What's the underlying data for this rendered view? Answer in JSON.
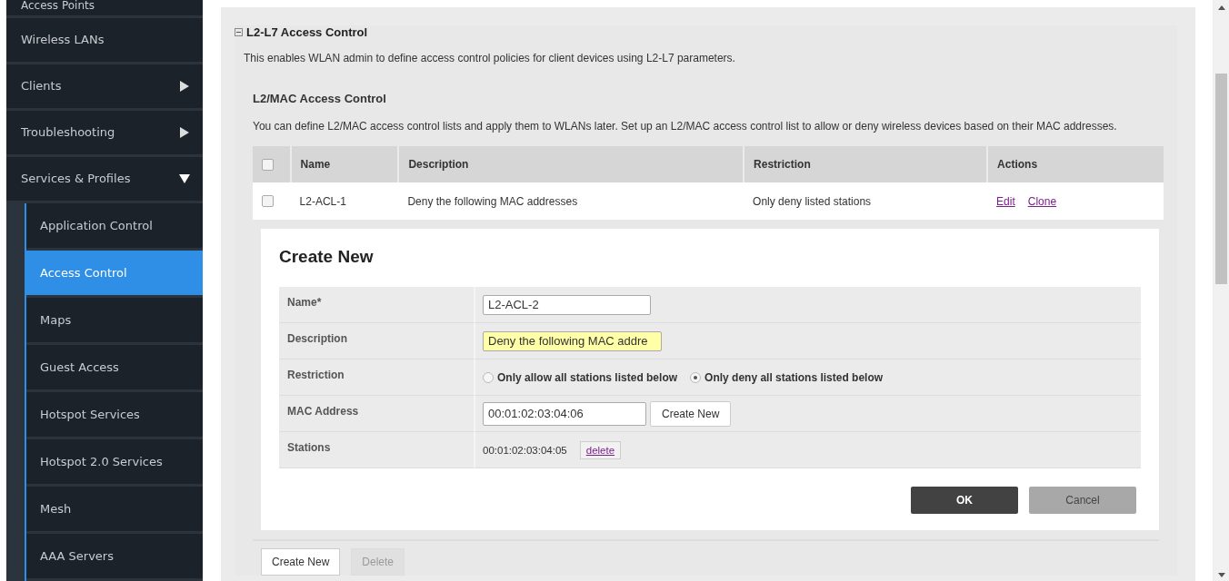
{
  "sidebar": {
    "items": [
      {
        "label": "Access Points",
        "kind": "link"
      },
      {
        "label": "Wireless LANs",
        "kind": "link"
      },
      {
        "label": "Clients",
        "kind": "group",
        "expanded": false
      },
      {
        "label": "Troubleshooting",
        "kind": "group",
        "expanded": false
      },
      {
        "label": "Services & Profiles",
        "kind": "group",
        "expanded": true,
        "children": [
          {
            "label": "Application Control",
            "selected": false
          },
          {
            "label": "Access Control",
            "selected": true
          },
          {
            "label": "Maps",
            "selected": false
          },
          {
            "label": "Guest Access",
            "selected": false
          },
          {
            "label": "Hotspot Services",
            "selected": false
          },
          {
            "label": "Hotspot 2.0 Services",
            "selected": false
          },
          {
            "label": "Mesh",
            "selected": false
          },
          {
            "label": "AAA Servers",
            "selected": false
          }
        ]
      }
    ]
  },
  "section": {
    "title": "L2-L7 Access Control",
    "expanded": true,
    "description": "This enables WLAN admin to define access control policies for client devices using L2-L7 parameters.",
    "subsection": {
      "title": "L2/MAC Access Control",
      "description": "You can define L2/MAC access control lists and apply them to WLANs later. Set up an L2/MAC access control list to allow or deny wireless devices based on their MAC addresses.",
      "table": {
        "select_all_checked": false,
        "columns": [
          "Name",
          "Description",
          "Restriction",
          "Actions"
        ],
        "rows": [
          {
            "checked": false,
            "cells": [
              "L2-ACL-1",
              "Deny the following MAC addresses",
              "Only deny listed stations"
            ],
            "actions": [
              "Edit",
              "Clone"
            ]
          }
        ]
      },
      "create_form": {
        "title": "Create New",
        "name": {
          "label": "Name*",
          "value": "L2-ACL-2"
        },
        "description": {
          "label": "Description",
          "value": "Deny the following MAC addre"
        },
        "restriction": {
          "label": "Restriction",
          "options": [
            {
              "label": "Only allow all stations listed below",
              "selected": false
            },
            {
              "label": "Only deny all stations listed below",
              "selected": true
            }
          ]
        },
        "mac_address": {
          "label": "MAC Address",
          "value": "00:01:02:03:04:06",
          "button": "Create New"
        },
        "stations": {
          "label": "Stations",
          "entries": [
            {
              "mac": "00:01:02:03:04:05",
              "action": "delete"
            }
          ]
        },
        "buttons": [
          "OK",
          "Cancel"
        ]
      },
      "footer_buttons": [
        {
          "label": "Create New",
          "disabled": false
        },
        {
          "label": "Delete",
          "disabled": true
        }
      ]
    }
  }
}
